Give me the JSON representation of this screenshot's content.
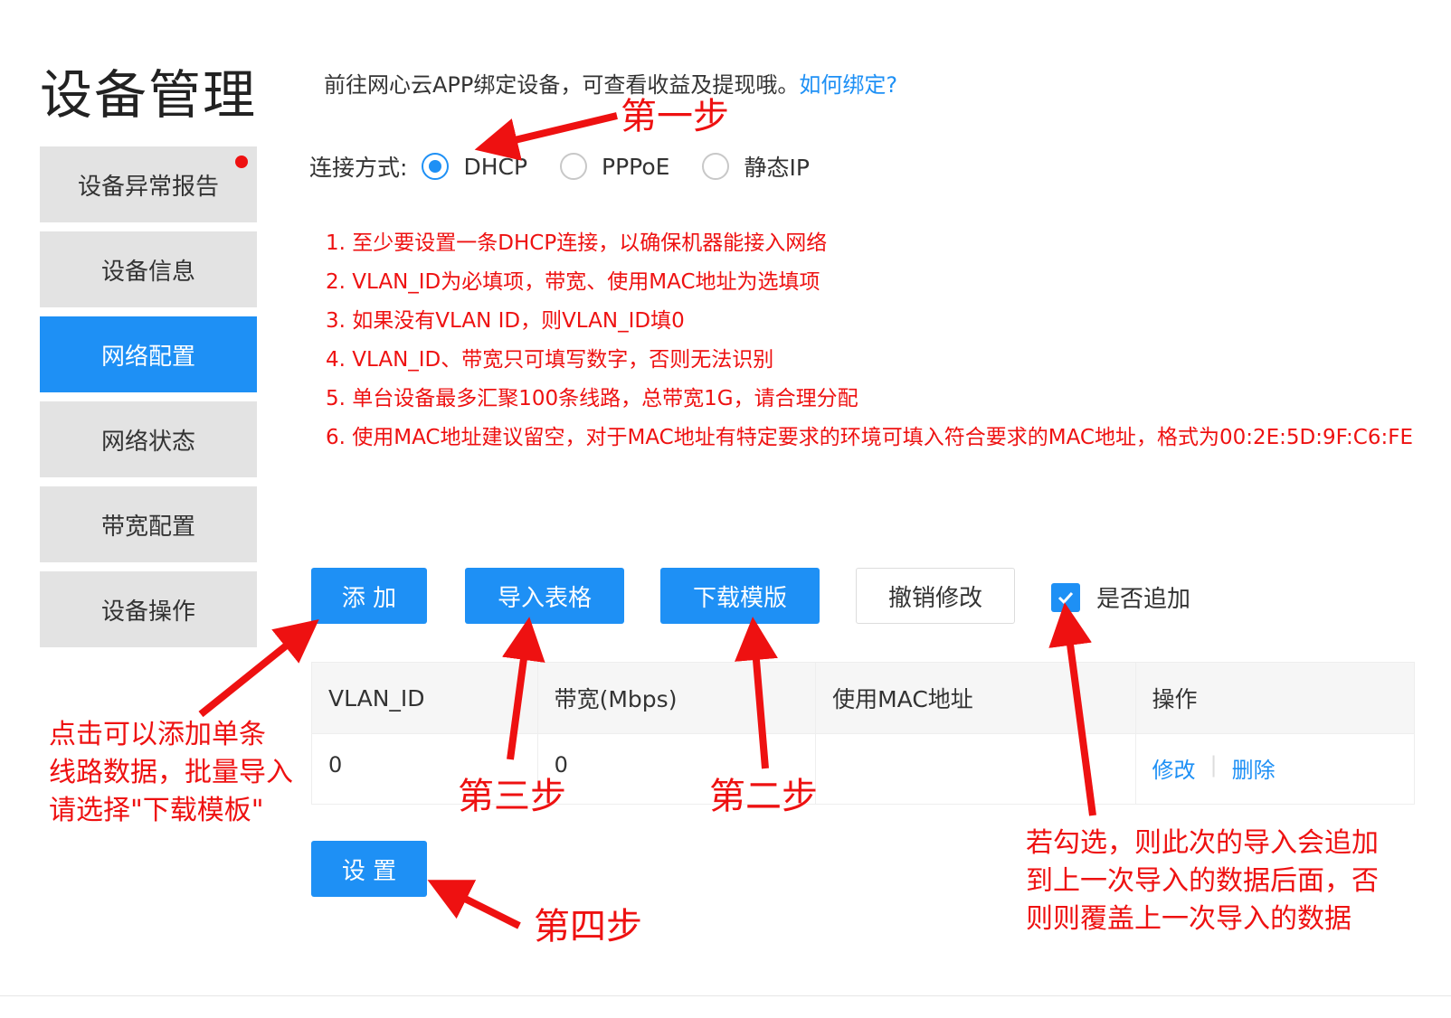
{
  "page_title": "设备管理",
  "sidebar": {
    "items": [
      {
        "label": "设备异常报告",
        "badge": true
      },
      {
        "label": "设备信息"
      },
      {
        "label": "网络配置",
        "active": true
      },
      {
        "label": "网络状态"
      },
      {
        "label": "带宽配置"
      },
      {
        "label": "设备操作"
      }
    ]
  },
  "tip": {
    "text": "前往网心云APP绑定设备，可查看收益及提现哦。",
    "link": "如何绑定?"
  },
  "connection": {
    "label": "连接方式:",
    "options": [
      "DHCP",
      "PPPoE",
      "静态IP"
    ],
    "selected": "DHCP"
  },
  "rules": [
    "1. 至少要设置一条DHCP连接，以确保机器能接入网络",
    "2. VLAN_ID为必填项，带宽、使用MAC地址为选填项",
    "3. 如果没有VLAN ID，则VLAN_ID填0",
    "4. VLAN_ID、带宽只可填写数字，否则无法识别",
    "5. 单台设备最多汇聚100条线路，总带宽1G，请合理分配",
    "6. 使用MAC地址建议留空，对于MAC地址有特定要求的环境可填入符合要求的MAC地址，格式为00:2E:5D:9F:C6:FE"
  ],
  "toolbar": {
    "add": "添 加",
    "import": "导入表格",
    "download": "下载模版",
    "undo": "撤销修改",
    "append_label": "是否追加",
    "append_checked": true
  },
  "table": {
    "headers": [
      "VLAN_ID",
      "带宽(Mbps)",
      "使用MAC地址",
      "操作"
    ],
    "rows": [
      {
        "vlan_id": "0",
        "bandwidth": "0",
        "mac": "",
        "edit": "修改",
        "delete": "删除"
      }
    ]
  },
  "submit_label": "设 置",
  "annotations": {
    "step1": "第一步",
    "step2": "第二步",
    "step3": "第三步",
    "step4": "第四步",
    "add_note": [
      "点击可以添加单条",
      "线路数据，批量导入",
      "请选择\"下载模板\""
    ],
    "append_note": [
      "若勾选，则此次的导入会追加",
      "到上一次导入的数据后面，否",
      "则则覆盖上一次导入的数据"
    ]
  },
  "colors": {
    "accent": "#1e90f5",
    "annotation": "#ee1111",
    "sidebar_bg": "#e3e3e3"
  }
}
